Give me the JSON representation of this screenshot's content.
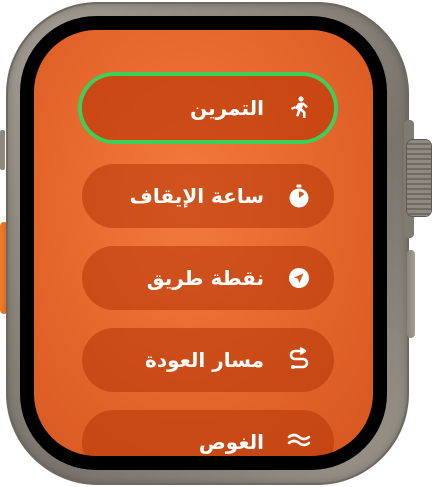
{
  "menu": {
    "items": [
      {
        "label": "التمرين",
        "icon": "running-figure-icon",
        "selected": true
      },
      {
        "label": "ساعة الإيقاف",
        "icon": "stopwatch-icon",
        "selected": false
      },
      {
        "label": "نقطة طريق",
        "icon": "waypoint-arrow-icon",
        "selected": false
      },
      {
        "label": "مسار العودة",
        "icon": "backtrack-route-icon",
        "selected": false
      },
      {
        "label": "الغوص",
        "icon": "dive-icon",
        "selected": false
      }
    ]
  },
  "colors": {
    "screen_background": "#e8692d",
    "menu_item_background": "#b43408",
    "selection_ring": "#3ccf5a",
    "text": "#ffffff"
  }
}
